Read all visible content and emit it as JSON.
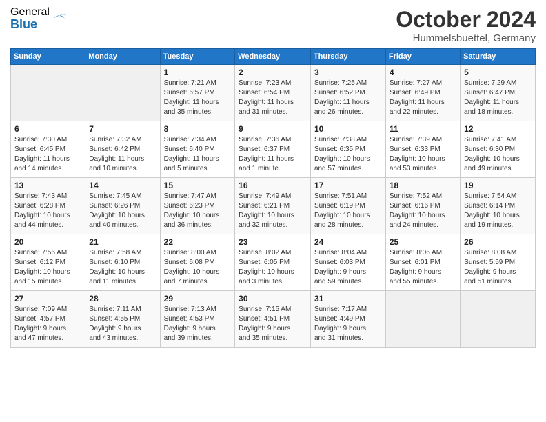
{
  "logo": {
    "general": "General",
    "blue": "Blue"
  },
  "title": "October 2024",
  "subtitle": "Hummelsbuettel, Germany",
  "weekdays": [
    "Sunday",
    "Monday",
    "Tuesday",
    "Wednesday",
    "Thursday",
    "Friday",
    "Saturday"
  ],
  "weeks": [
    [
      {
        "day": "",
        "info": ""
      },
      {
        "day": "",
        "info": ""
      },
      {
        "day": "1",
        "info": "Sunrise: 7:21 AM\nSunset: 6:57 PM\nDaylight: 11 hours\nand 35 minutes."
      },
      {
        "day": "2",
        "info": "Sunrise: 7:23 AM\nSunset: 6:54 PM\nDaylight: 11 hours\nand 31 minutes."
      },
      {
        "day": "3",
        "info": "Sunrise: 7:25 AM\nSunset: 6:52 PM\nDaylight: 11 hours\nand 26 minutes."
      },
      {
        "day": "4",
        "info": "Sunrise: 7:27 AM\nSunset: 6:49 PM\nDaylight: 11 hours\nand 22 minutes."
      },
      {
        "day": "5",
        "info": "Sunrise: 7:29 AM\nSunset: 6:47 PM\nDaylight: 11 hours\nand 18 minutes."
      }
    ],
    [
      {
        "day": "6",
        "info": "Sunrise: 7:30 AM\nSunset: 6:45 PM\nDaylight: 11 hours\nand 14 minutes."
      },
      {
        "day": "7",
        "info": "Sunrise: 7:32 AM\nSunset: 6:42 PM\nDaylight: 11 hours\nand 10 minutes."
      },
      {
        "day": "8",
        "info": "Sunrise: 7:34 AM\nSunset: 6:40 PM\nDaylight: 11 hours\nand 5 minutes."
      },
      {
        "day": "9",
        "info": "Sunrise: 7:36 AM\nSunset: 6:37 PM\nDaylight: 11 hours\nand 1 minute."
      },
      {
        "day": "10",
        "info": "Sunrise: 7:38 AM\nSunset: 6:35 PM\nDaylight: 10 hours\nand 57 minutes."
      },
      {
        "day": "11",
        "info": "Sunrise: 7:39 AM\nSunset: 6:33 PM\nDaylight: 10 hours\nand 53 minutes."
      },
      {
        "day": "12",
        "info": "Sunrise: 7:41 AM\nSunset: 6:30 PM\nDaylight: 10 hours\nand 49 minutes."
      }
    ],
    [
      {
        "day": "13",
        "info": "Sunrise: 7:43 AM\nSunset: 6:28 PM\nDaylight: 10 hours\nand 44 minutes."
      },
      {
        "day": "14",
        "info": "Sunrise: 7:45 AM\nSunset: 6:26 PM\nDaylight: 10 hours\nand 40 minutes."
      },
      {
        "day": "15",
        "info": "Sunrise: 7:47 AM\nSunset: 6:23 PM\nDaylight: 10 hours\nand 36 minutes."
      },
      {
        "day": "16",
        "info": "Sunrise: 7:49 AM\nSunset: 6:21 PM\nDaylight: 10 hours\nand 32 minutes."
      },
      {
        "day": "17",
        "info": "Sunrise: 7:51 AM\nSunset: 6:19 PM\nDaylight: 10 hours\nand 28 minutes."
      },
      {
        "day": "18",
        "info": "Sunrise: 7:52 AM\nSunset: 6:16 PM\nDaylight: 10 hours\nand 24 minutes."
      },
      {
        "day": "19",
        "info": "Sunrise: 7:54 AM\nSunset: 6:14 PM\nDaylight: 10 hours\nand 19 minutes."
      }
    ],
    [
      {
        "day": "20",
        "info": "Sunrise: 7:56 AM\nSunset: 6:12 PM\nDaylight: 10 hours\nand 15 minutes."
      },
      {
        "day": "21",
        "info": "Sunrise: 7:58 AM\nSunset: 6:10 PM\nDaylight: 10 hours\nand 11 minutes."
      },
      {
        "day": "22",
        "info": "Sunrise: 8:00 AM\nSunset: 6:08 PM\nDaylight: 10 hours\nand 7 minutes."
      },
      {
        "day": "23",
        "info": "Sunrise: 8:02 AM\nSunset: 6:05 PM\nDaylight: 10 hours\nand 3 minutes."
      },
      {
        "day": "24",
        "info": "Sunrise: 8:04 AM\nSunset: 6:03 PM\nDaylight: 9 hours\nand 59 minutes."
      },
      {
        "day": "25",
        "info": "Sunrise: 8:06 AM\nSunset: 6:01 PM\nDaylight: 9 hours\nand 55 minutes."
      },
      {
        "day": "26",
        "info": "Sunrise: 8:08 AM\nSunset: 5:59 PM\nDaylight: 9 hours\nand 51 minutes."
      }
    ],
    [
      {
        "day": "27",
        "info": "Sunrise: 7:09 AM\nSunset: 4:57 PM\nDaylight: 9 hours\nand 47 minutes."
      },
      {
        "day": "28",
        "info": "Sunrise: 7:11 AM\nSunset: 4:55 PM\nDaylight: 9 hours\nand 43 minutes."
      },
      {
        "day": "29",
        "info": "Sunrise: 7:13 AM\nSunset: 4:53 PM\nDaylight: 9 hours\nand 39 minutes."
      },
      {
        "day": "30",
        "info": "Sunrise: 7:15 AM\nSunset: 4:51 PM\nDaylight: 9 hours\nand 35 minutes."
      },
      {
        "day": "31",
        "info": "Sunrise: 7:17 AM\nSunset: 4:49 PM\nDaylight: 9 hours\nand 31 minutes."
      },
      {
        "day": "",
        "info": ""
      },
      {
        "day": "",
        "info": ""
      }
    ]
  ]
}
